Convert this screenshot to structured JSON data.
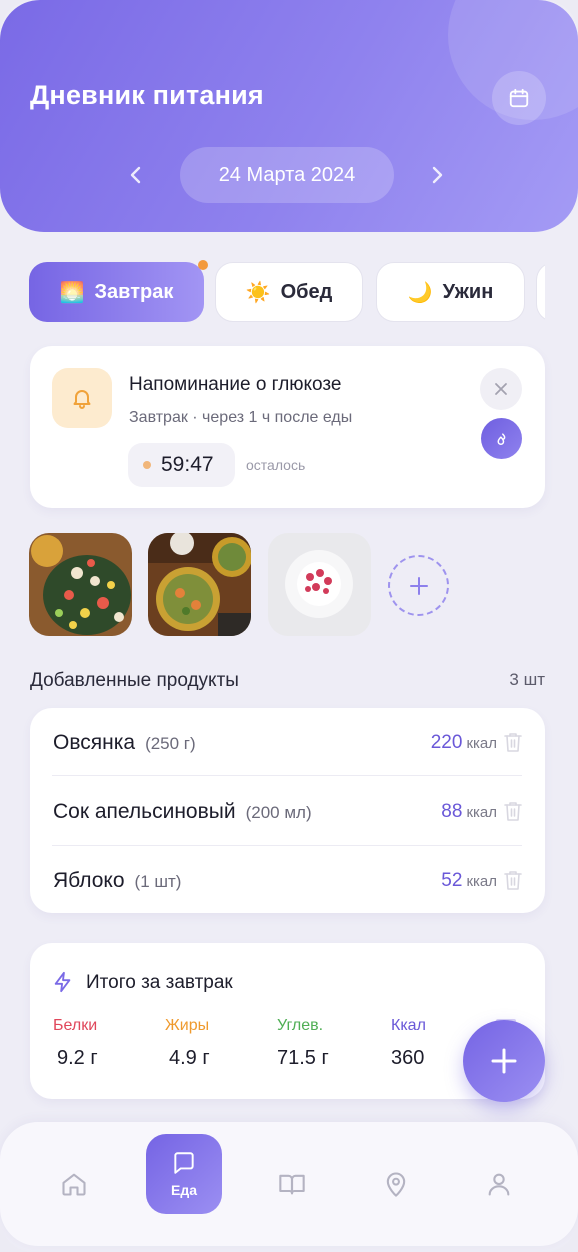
{
  "header": {
    "title": "Дневник питания",
    "date": "24 Марта 2024",
    "calendar_icon": "calendar-icon",
    "prev_icon": "chevron-left-icon",
    "next_icon": "chevron-right-icon"
  },
  "tabs": [
    {
      "label": "Завтрак",
      "icon": "🌅",
      "active": true,
      "has_badge": true
    },
    {
      "label": "Обед",
      "icon": "☀️",
      "active": false
    },
    {
      "label": "Ужин",
      "icon": "🌙",
      "active": false
    }
  ],
  "reminder": {
    "title": "Напоминание о глюкозе",
    "subtitle": "Завтрак · через 1 ч после еды",
    "timer": "59:47",
    "remaining_label": "осталось"
  },
  "products": {
    "header": "Добавленные продукты",
    "count": "3 шт",
    "items": [
      {
        "name": "Овсянка",
        "qty": "(250 г)",
        "kcal": "220",
        "unit": "ккал"
      },
      {
        "name": "Сок апельсиновый",
        "qty": "(200 мл)",
        "kcal": "88",
        "unit": "ккал"
      },
      {
        "name": "Яблоко",
        "qty": "(1 шт)",
        "kcal": "52",
        "unit": "ккал"
      }
    ]
  },
  "totals": {
    "title": "Итого за завтрак",
    "macros": [
      {
        "label": "Белки",
        "value": "9.2 г",
        "color": "#e0475b"
      },
      {
        "label": "Жиры",
        "value": "4.9 г",
        "color": "#ef9a2e"
      },
      {
        "label": "Углев.",
        "value": "71.5 г",
        "color": "#4fae54"
      },
      {
        "label": "Ккал",
        "value": "360",
        "color": "#6a58d8"
      }
    ]
  },
  "nav": {
    "active_label": "Еда",
    "items": [
      "home-icon",
      "food-icon",
      "book-icon",
      "location-icon",
      "profile-icon"
    ]
  },
  "colors": {
    "accent": "#7a6ae6",
    "accent_light": "#a49bf5",
    "background": "#eeedf6"
  }
}
